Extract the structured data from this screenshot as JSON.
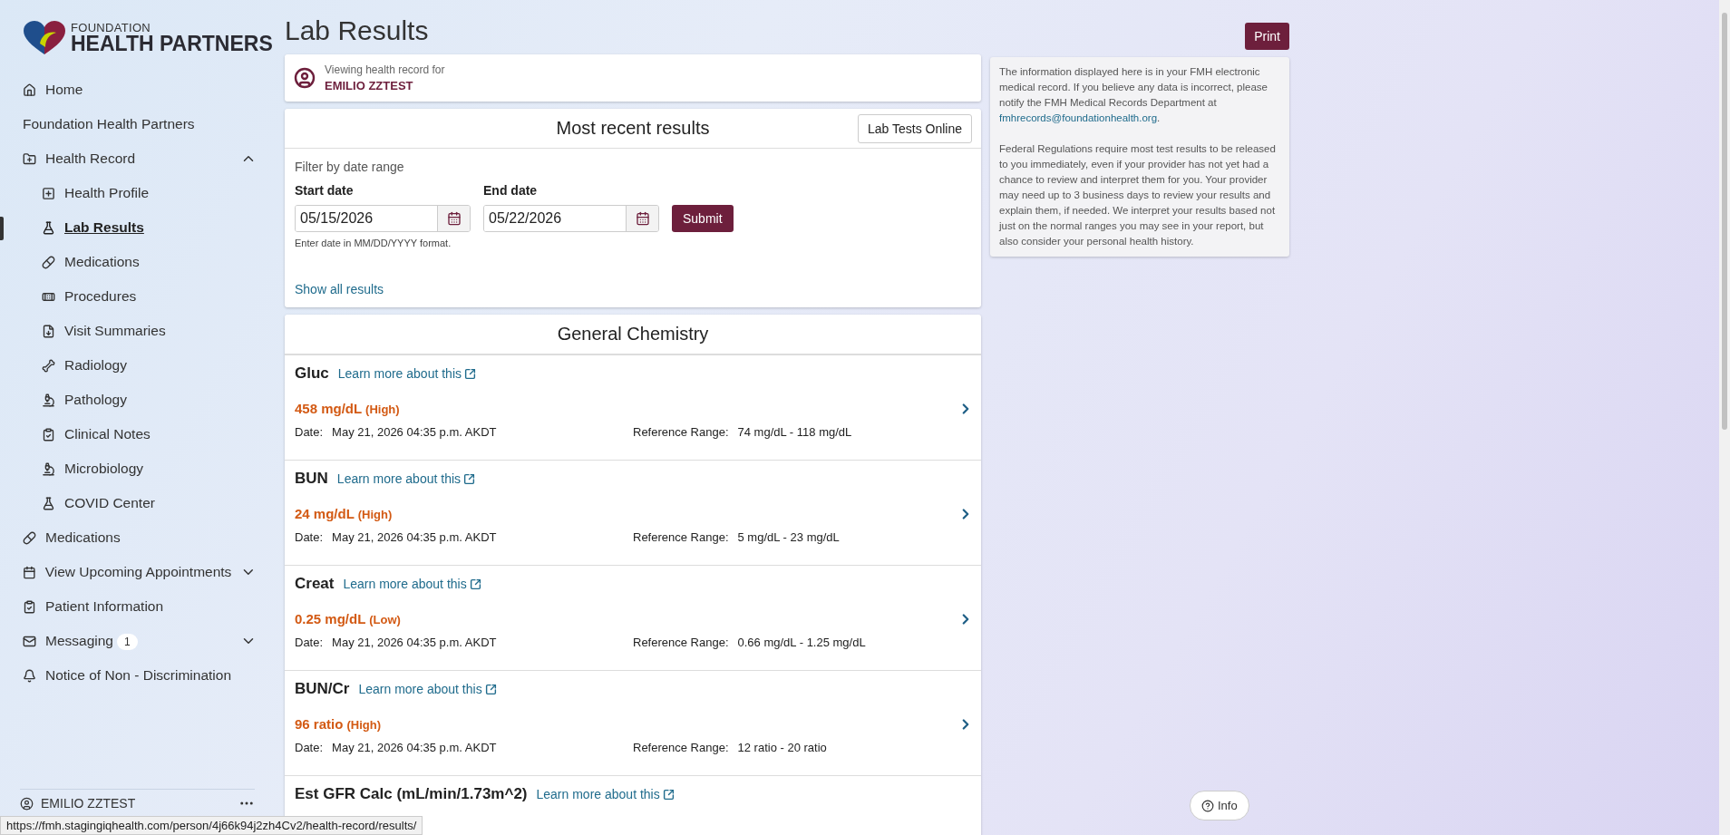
{
  "logo": {
    "line_1": "FOUNDATION",
    "line_2": "HEALTH PARTNERS"
  },
  "sidebar": {
    "items": [
      {
        "label": "Home",
        "kind": "link",
        "selected": false
      },
      {
        "label": "Foundation Health Partners",
        "kind": "link",
        "selected": false
      },
      {
        "label": "Health Record",
        "kind": "group",
        "expanded": true,
        "selected": false,
        "children": [
          {
            "label": "Health Profile",
            "selected": false
          },
          {
            "label": "Lab Results",
            "selected": true
          },
          {
            "label": "Medications",
            "selected": false
          },
          {
            "label": "Procedures",
            "selected": false
          },
          {
            "label": "Visit Summaries",
            "selected": false
          },
          {
            "label": "Radiology",
            "selected": false
          },
          {
            "label": "Pathology",
            "selected": false
          },
          {
            "label": "Clinical Notes",
            "selected": false
          },
          {
            "label": "Microbiology",
            "selected": false
          },
          {
            "label": "COVID Center",
            "selected": false
          }
        ]
      },
      {
        "label": "Medications",
        "kind": "link",
        "selected": false
      },
      {
        "label": "View Upcoming Appointments",
        "kind": "group",
        "expanded": false,
        "selected": false
      },
      {
        "label": "Patient Information",
        "kind": "link",
        "selected": false
      },
      {
        "label": "Messaging",
        "kind": "group",
        "expanded": false,
        "selected": false,
        "badge": "1"
      },
      {
        "label": "Notice of Non - Discrimination",
        "kind": "link",
        "selected": false
      }
    ]
  },
  "user": {
    "name": "EMILIO ZZTEST"
  },
  "page_title": "Lab Results",
  "print_button": "Print",
  "patient": {
    "caption": "Viewing health record for",
    "name": "EMILIO ZZTEST"
  },
  "filter": {
    "title": "Most recent results",
    "lab_tests_button": "Lab Tests Online",
    "caption": "Filter by date range",
    "start": {
      "label": "Start date",
      "value": "05/15/2026"
    },
    "end": {
      "label": "End date",
      "value": "05/22/2026"
    },
    "submit": "Submit",
    "hint": "Enter date in MM/DD/YYYY format.",
    "show_all": "Show all results"
  },
  "section": {
    "title": "General Chemistry",
    "results": [
      {
        "name": "Gluc",
        "link": "Learn more about this",
        "value": "458 mg/dL",
        "flag": "(High)",
        "date_label": "Date:",
        "date": "May 21, 2026 04:35 p.m. AKDT",
        "range_label": "Reference Range:",
        "range": "74 mg/dL - 118 mg/dL"
      },
      {
        "name": "BUN",
        "link": "Learn more about this",
        "value": "24 mg/dL",
        "flag": "(High)",
        "date_label": "Date:",
        "date": "May 21, 2026 04:35 p.m. AKDT",
        "range_label": "Reference Range:",
        "range": "5 mg/dL - 23 mg/dL"
      },
      {
        "name": "Creat",
        "link": "Learn more about this",
        "value": "0.25 mg/dL",
        "flag": "(Low)",
        "date_label": "Date:",
        "date": "May 21, 2026 04:35 p.m. AKDT",
        "range_label": "Reference Range:",
        "range": "0.66 mg/dL - 1.25 mg/dL"
      },
      {
        "name": "BUN/Cr",
        "link": "Learn more about this",
        "value": "96 ratio",
        "flag": "(High)",
        "date_label": "Date:",
        "date": "May 21, 2026 04:35 p.m. AKDT",
        "range_label": "Reference Range:",
        "range": "12 ratio - 20 ratio"
      },
      {
        "name": "Est GFR Calc (mL/min/1.73m^2)",
        "link": "Learn more about this"
      }
    ]
  },
  "info": {
    "paragraph_1": "The information displayed here is in your FMH electronic medical record. If you believe any data is incorrect, please notify the FMH Medical Records Department at",
    "email": "fmhrecords@foundationhealth.org",
    "paragraph_1_end": ".",
    "paragraph_2": "Federal Regulations require most test results to be released to you immediately, even if your provider has not yet had a chance to review and interpret them for you. Your provider may need up to 3 business days to review your results and explain them, if needed.  We interpret your results based not just on the normal ranges you may see in your report, but also consider your personal health history."
  },
  "info_button": "Info",
  "status_url": "https://fmh.stagingiqhealth.com/person/4j66k94j2zh4Cv2/health-record/results/"
}
